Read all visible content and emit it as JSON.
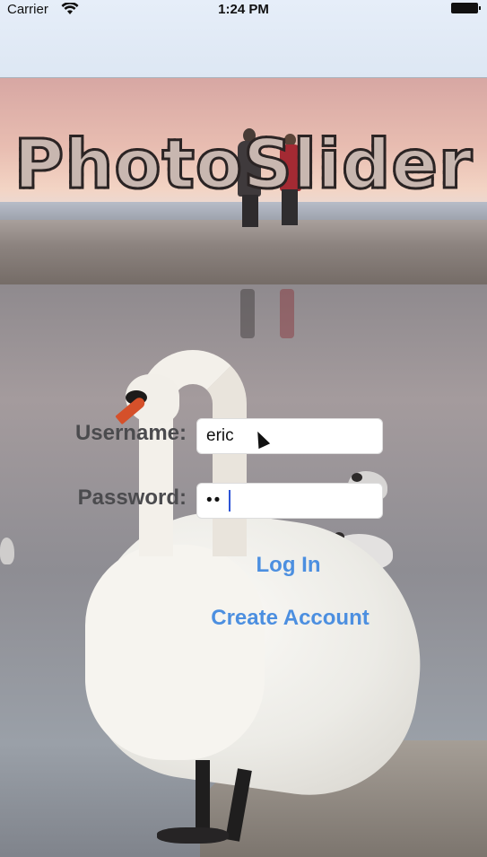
{
  "status_bar": {
    "carrier": "Carrier",
    "time": "1:24 PM",
    "wifi_icon": "wifi-icon",
    "battery_icon": "battery-icon"
  },
  "app": {
    "logo_text": "PhotoSlider"
  },
  "form": {
    "username_label": "Username:",
    "username_value": "eric",
    "password_label": "Password:",
    "password_masked": "••"
  },
  "actions": {
    "login_label": "Log In",
    "create_account_label": "Create Account"
  },
  "colors": {
    "accent": "#4c8fe0",
    "label": "#4b4b4e"
  }
}
